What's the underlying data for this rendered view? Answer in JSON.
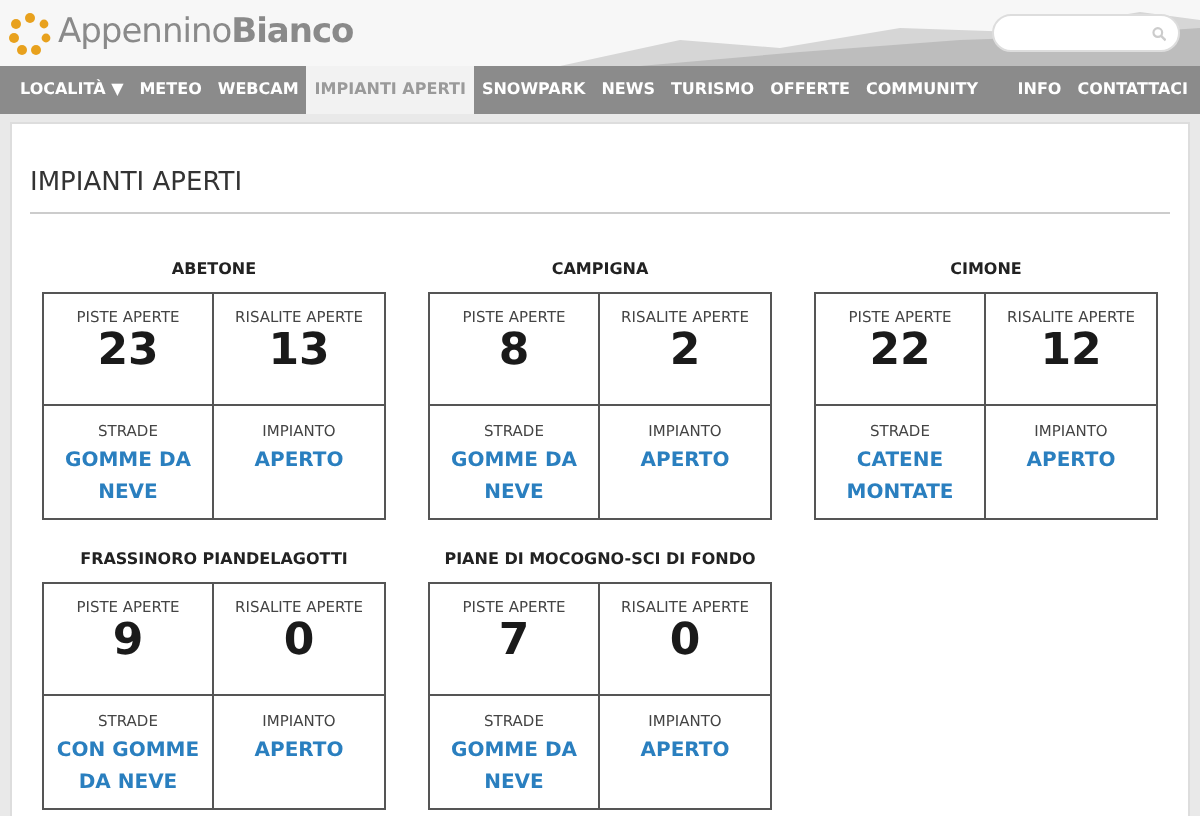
{
  "logo": {
    "text_light": "Appennino",
    "text_bold": "Bianco"
  },
  "nav": [
    {
      "label": "LOCALITÀ ▼",
      "selected": false
    },
    {
      "label": "METEO",
      "selected": false
    },
    {
      "label": "WEBCAM",
      "selected": false
    },
    {
      "label": "IMPIANTI APERTI",
      "selected": true
    },
    {
      "label": "SNOWPARK",
      "selected": false
    },
    {
      "label": "NEWS",
      "selected": false
    },
    {
      "label": "TURISMO",
      "selected": false
    },
    {
      "label": "OFFERTE",
      "selected": false
    },
    {
      "label": "COMMUNITY",
      "selected": false
    }
  ],
  "nav_right": [
    {
      "label": "INFO",
      "selected": false
    },
    {
      "label": "CONTATTACI",
      "selected": false
    }
  ],
  "page_title": "IMPIANTI APERTI",
  "resorts": [
    {
      "name": "ABETONE",
      "cells": [
        {
          "kind": "count",
          "label": "PISTE APERTE",
          "value": "23"
        },
        {
          "kind": "count",
          "label": "RISALITE APERTE",
          "value": "13"
        },
        {
          "kind": "status",
          "label": "STRADE",
          "value": "GOMME DA NEVE"
        },
        {
          "kind": "status",
          "label": "IMPIANTO",
          "value": "APERTO"
        }
      ]
    },
    {
      "name": "CAMPIGNA",
      "cells": [
        {
          "kind": "count",
          "label": "PISTE APERTE",
          "value": "8"
        },
        {
          "kind": "count",
          "label": "RISALITE APERTE",
          "value": "2"
        },
        {
          "kind": "status",
          "label": "STRADE",
          "value": "GOMME DA NEVE"
        },
        {
          "kind": "status",
          "label": "IMPIANTO",
          "value": "APERTO"
        }
      ]
    },
    {
      "name": "CIMONE",
      "cells": [
        {
          "kind": "count",
          "label": "PISTE APERTE",
          "value": "22"
        },
        {
          "kind": "count",
          "label": "RISALITE APERTE",
          "value": "12"
        },
        {
          "kind": "status",
          "label": "STRADE",
          "value": "CATENE MONTATE"
        },
        {
          "kind": "status",
          "label": "IMPIANTO",
          "value": "APERTO"
        }
      ]
    },
    {
      "name": "FRASSINORO PIANDELAGOTTI",
      "cells": [
        {
          "kind": "count",
          "label": "PISTE APERTE",
          "value": "9"
        },
        {
          "kind": "count",
          "label": "RISALITE APERTE",
          "value": "0"
        },
        {
          "kind": "status",
          "label": "STRADE",
          "value": "CON GOMME DA NEVE"
        },
        {
          "kind": "status",
          "label": "IMPIANTO",
          "value": "APERTO"
        }
      ]
    },
    {
      "name": "PIANE DI MOCOGNO-SCI DI FONDO",
      "cells": [
        {
          "kind": "count",
          "label": "PISTE APERTE",
          "value": "7"
        },
        {
          "kind": "count",
          "label": "RISALITE APERTE",
          "value": "0"
        },
        {
          "kind": "status",
          "label": "STRADE",
          "value": "GOMME DA NEVE"
        },
        {
          "kind": "status",
          "label": "IMPIANTO",
          "value": "APERTO"
        }
      ]
    }
  ]
}
